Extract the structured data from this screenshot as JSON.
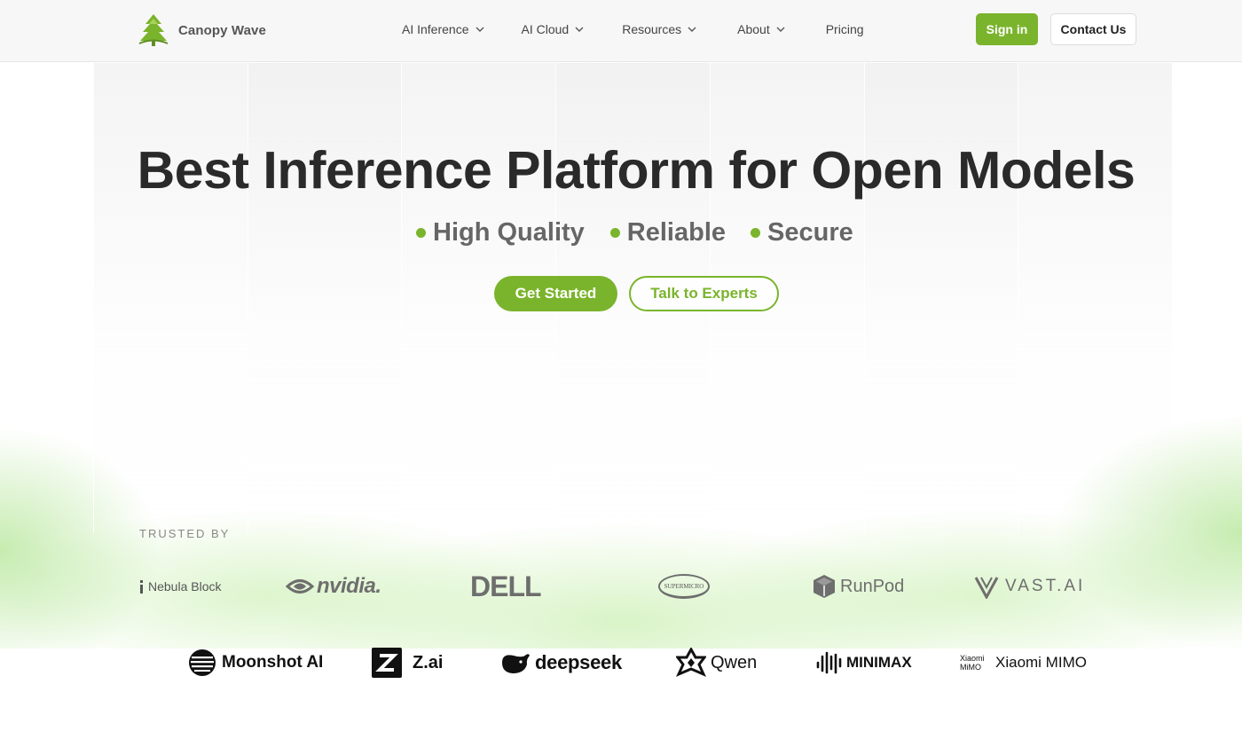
{
  "brand": {
    "name": "Canopy Wave",
    "accent": "#7ab42c"
  },
  "nav": {
    "items": [
      {
        "label": "AI Inference",
        "has_dropdown": true
      },
      {
        "label": "AI Cloud",
        "has_dropdown": true
      },
      {
        "label": "Resources",
        "has_dropdown": true
      },
      {
        "label": "About",
        "has_dropdown": true
      },
      {
        "label": "Pricing",
        "has_dropdown": false
      }
    ],
    "sign_in": "Sign in",
    "contact": "Contact Us"
  },
  "hero": {
    "title": "Best Inference Platform for Open Models",
    "features": [
      "High Quality",
      "Reliable",
      "Secure"
    ],
    "primary_cta": "Get Started",
    "secondary_cta": "Talk to Experts"
  },
  "trusted": {
    "label": "TRUSTED BY",
    "partners": [
      "Nebula Block",
      "nvidia.",
      "DELL",
      "SUPERMICRO",
      "RunPod",
      "VAST.AI"
    ],
    "models": [
      "Moonshot AI",
      "Z.ai",
      "deepseek",
      "Qwen",
      "MINIMAX",
      "Xiaomi MIMO"
    ],
    "xiaomi_small": "Xiaomi MiMO"
  }
}
